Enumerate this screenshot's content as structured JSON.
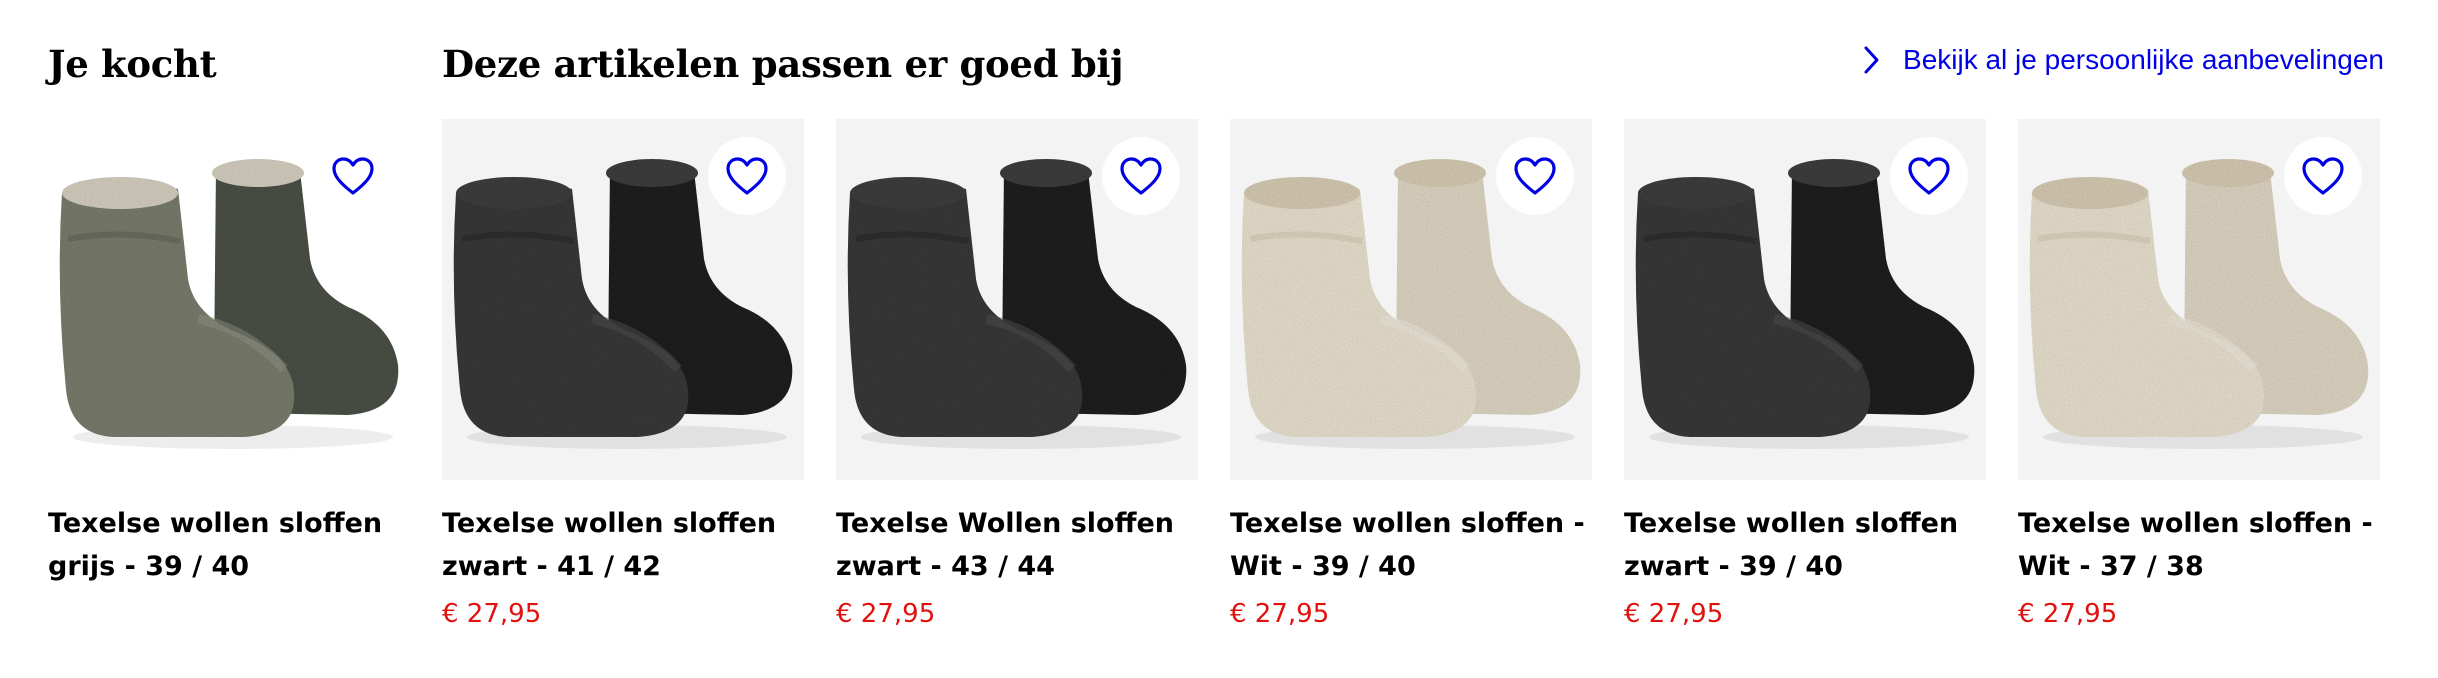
{
  "bought": {
    "title": "Je kocht",
    "product": {
      "name": "Texelse wollen sloffen grijs - 39 / 40",
      "color": "grey"
    }
  },
  "suggestions": {
    "title": "Deze artikelen passen er goed bij",
    "link_label": "Bekijk al je persoonlijke aanbevelingen",
    "items": [
      {
        "name": "Texelse wollen sloffen zwart - 41 / 42",
        "price": "€ 27,95",
        "color": "charcoal"
      },
      {
        "name": "Texelse Wollen sloffen zwart - 43 / 44",
        "price": "€ 27,95",
        "color": "charcoal"
      },
      {
        "name": "Texelse wollen sloffen - Wit - 39 / 40",
        "price": "€ 27,95",
        "color": "cream"
      },
      {
        "name": "Texelse wollen sloffen zwart - 39 / 40",
        "price": "€ 27,95",
        "color": "charcoal"
      },
      {
        "name": "Texelse wollen sloffen - Wit - 37 / 38",
        "price": "€ 27,95",
        "color": "cream"
      }
    ]
  },
  "icons": {
    "favorite": "heart-outline-icon",
    "link": "chevron-right-icon"
  },
  "colors": {
    "accent": "#0000e6",
    "price": "#e0120e",
    "image_bg": "#f3f3f3"
  }
}
